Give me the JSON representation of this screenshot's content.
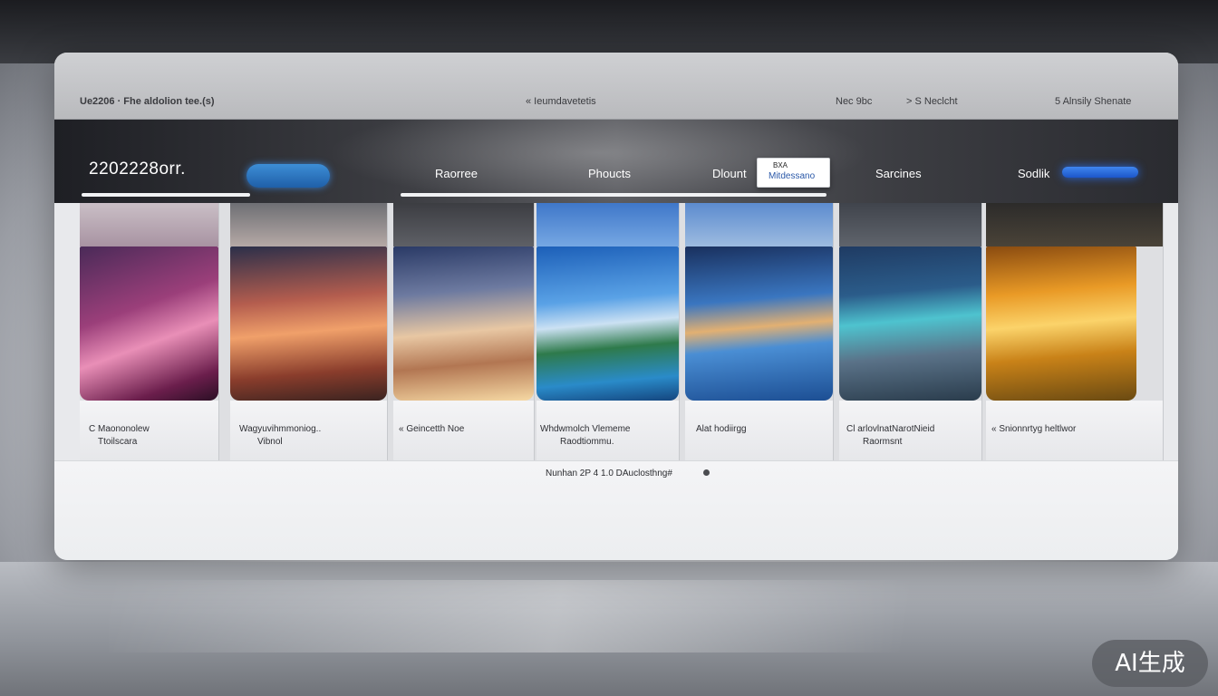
{
  "system_bar": {
    "left_text": "Ue2206 · Fhe aldolion tee.(s)",
    "center_text": "« Ieumdavetetis",
    "mid_text_1": "Nec  9bc",
    "mid_text_2": ">  S  Neclcht",
    "right_text": "5  Alnsily   Shenate"
  },
  "header": {
    "brand": "2202228orr.",
    "nav": {
      "home": "Raorree",
      "products": "Phoucts",
      "about": "Dlount",
      "services": "Sarcines",
      "social": "Sodlik"
    },
    "popup": {
      "tag": "BXA",
      "text": "Mitdessano"
    }
  },
  "gallery": {
    "cards": [
      {
        "caption_1": "C Maononolew",
        "caption_2": "Ttoilscara"
      },
      {
        "caption_1": "Wagyuvihmmoniog..",
        "caption_2": "Vibnol"
      },
      {
        "caption_1": "« Geincetth Noe",
        "caption_2": ""
      },
      {
        "caption_1": "Whdwmolch Vlememe",
        "caption_2": "Raodtiommu."
      },
      {
        "caption_1": "Alat hodiirgg",
        "caption_2": ""
      },
      {
        "caption_1": "Cl arlovlnatNarotNieid",
        "caption_2": "Raormsnt"
      },
      {
        "caption_1": "« Snionnrtyg heltlwor",
        "caption_2": ""
      }
    ]
  },
  "detail": {
    "text": "Nunhan 2P 4 1.0  DAuclosthng#"
  },
  "watermark": "AI生成",
  "colors": {
    "accent_blue": "#2f7fd8",
    "nav_background": "#2b2c31",
    "panel": "#eceef0"
  }
}
